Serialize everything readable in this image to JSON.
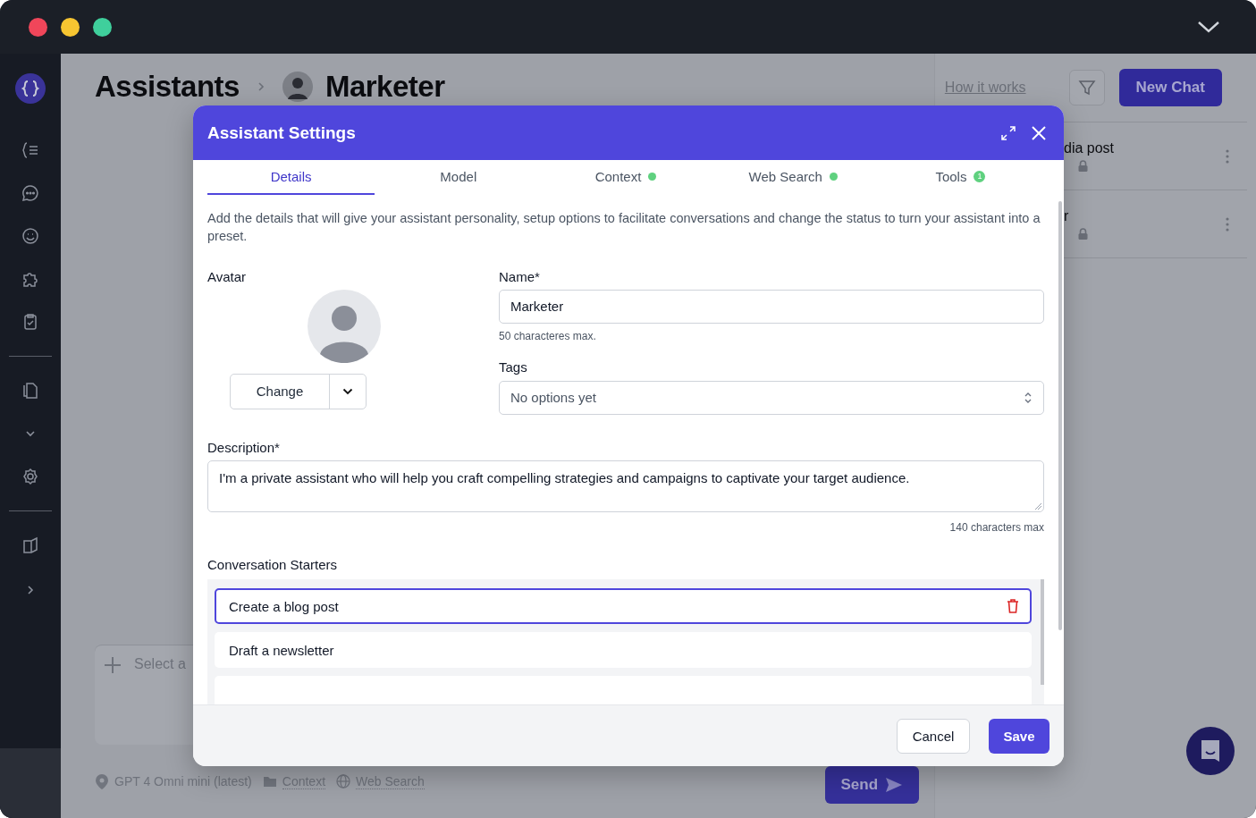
{
  "page": {
    "breadcrumb": [
      "Assistants",
      "Marketer"
    ]
  },
  "header_actions": {
    "link": "How it works",
    "new_chat": "New Chat"
  },
  "chat_list": [
    {
      "title": "dia post",
      "locked": true
    },
    {
      "title": "r",
      "locked": true
    }
  ],
  "composer": {
    "placeholder": "Select a",
    "model": "GPT 4 Omni mini (latest)",
    "context": "Context",
    "web_search": "Web Search",
    "send": "Send"
  },
  "dialog": {
    "title": "Assistant Settings",
    "tabs": [
      {
        "label": "Details",
        "selected": true
      },
      {
        "label": "Model",
        "selected": false
      },
      {
        "label": "Context",
        "selected": false,
        "badge": {
          "kind": "dot"
        }
      },
      {
        "label": "Web Search",
        "selected": false,
        "badge": {
          "kind": "dot"
        }
      },
      {
        "label": "Tools",
        "selected": false,
        "badge": {
          "kind": "count",
          "text": "1"
        }
      }
    ],
    "intro": "Add the details that will give your assistant personality, setup options to facilitate conversations and change the status to turn your assistant into a preset.",
    "avatar": {
      "label": "Avatar",
      "button": "Change"
    },
    "name": {
      "label": "Name*",
      "value": "Marketer",
      "hint": "50 characteres max."
    },
    "tags": {
      "label": "Tags",
      "placeholder": "No options yet"
    },
    "description": {
      "label": "Description*",
      "value": "I'm a private assistant who will help you craft compelling strategies and campaigns to captivate your target audience.",
      "hint": "140 characters max"
    },
    "starters": {
      "label": "Conversation Starters",
      "items": [
        {
          "text": "Create a blog post",
          "focused": true
        },
        {
          "text": "Draft a newsletter",
          "focused": false
        }
      ]
    },
    "buttons": {
      "cancel": "Cancel",
      "save": "Save"
    }
  }
}
